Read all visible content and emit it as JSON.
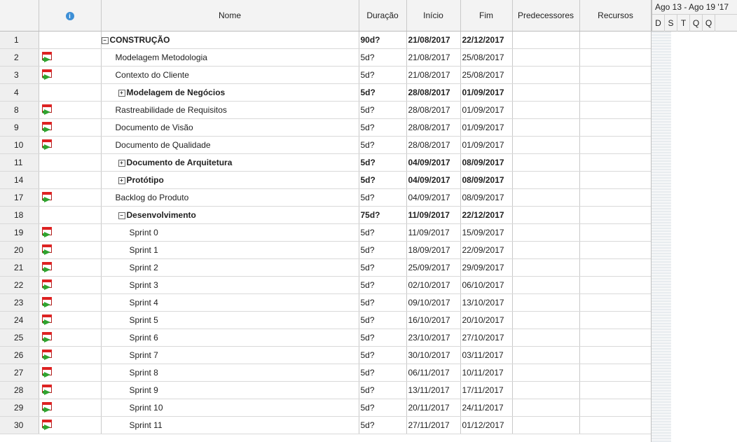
{
  "columns": {
    "name": "Nome",
    "duration": "Duração",
    "start": "Início",
    "finish": "Fim",
    "predecessors": "Predecessores",
    "resources": "Recursos"
  },
  "timeline": {
    "week_label": "Ago 13 - Ago 19 '17",
    "days": [
      "D",
      "S",
      "T",
      "Q",
      "Q"
    ]
  },
  "rows": [
    {
      "id": "1",
      "name": "CONSTRUÇÃO",
      "duration": "90d?",
      "start": "21/08/2017",
      "finish": "22/12/2017"
    },
    {
      "id": "2",
      "name": "Modelagem Metodologia",
      "duration": "5d?",
      "start": "21/08/2017",
      "finish": "25/08/2017"
    },
    {
      "id": "3",
      "name": "Contexto do Cliente",
      "duration": "5d?",
      "start": "21/08/2017",
      "finish": "25/08/2017"
    },
    {
      "id": "4",
      "name": "Modelagem de Negócios",
      "duration": "5d?",
      "start": "28/08/2017",
      "finish": "01/09/2017"
    },
    {
      "id": "8",
      "name": "Rastreabilidade de Requisitos",
      "duration": "5d?",
      "start": "28/08/2017",
      "finish": "01/09/2017"
    },
    {
      "id": "9",
      "name": "Documento de Visão",
      "duration": "5d?",
      "start": "28/08/2017",
      "finish": "01/09/2017"
    },
    {
      "id": "10",
      "name": "Documento de Qualidade",
      "duration": "5d?",
      "start": "28/08/2017",
      "finish": "01/09/2017"
    },
    {
      "id": "11",
      "name": "Documento de Arquitetura",
      "duration": "5d?",
      "start": "04/09/2017",
      "finish": "08/09/2017"
    },
    {
      "id": "14",
      "name": "Protótipo",
      "duration": "5d?",
      "start": "04/09/2017",
      "finish": "08/09/2017"
    },
    {
      "id": "17",
      "name": "Backlog do Produto",
      "duration": "5d?",
      "start": "04/09/2017",
      "finish": "08/09/2017"
    },
    {
      "id": "18",
      "name": "Desenvolvimento",
      "duration": "75d?",
      "start": "11/09/2017",
      "finish": "22/12/2017"
    },
    {
      "id": "19",
      "name": "Sprint 0",
      "duration": "5d?",
      "start": "11/09/2017",
      "finish": "15/09/2017"
    },
    {
      "id": "20",
      "name": "Sprint 1",
      "duration": "5d?",
      "start": "18/09/2017",
      "finish": "22/09/2017"
    },
    {
      "id": "21",
      "name": "Sprint 2",
      "duration": "5d?",
      "start": "25/09/2017",
      "finish": "29/09/2017"
    },
    {
      "id": "22",
      "name": "Sprint 3",
      "duration": "5d?",
      "start": "02/10/2017",
      "finish": "06/10/2017"
    },
    {
      "id": "23",
      "name": "Sprint 4",
      "duration": "5d?",
      "start": "09/10/2017",
      "finish": "13/10/2017"
    },
    {
      "id": "24",
      "name": "Sprint 5",
      "duration": "5d?",
      "start": "16/10/2017",
      "finish": "20/10/2017"
    },
    {
      "id": "25",
      "name": "Sprint 6",
      "duration": "5d?",
      "start": "23/10/2017",
      "finish": "27/10/2017"
    },
    {
      "id": "26",
      "name": "Sprint 7",
      "duration": "5d?",
      "start": "30/10/2017",
      "finish": "03/11/2017"
    },
    {
      "id": "27",
      "name": "Sprint 8",
      "duration": "5d?",
      "start": "06/11/2017",
      "finish": "10/11/2017"
    },
    {
      "id": "28",
      "name": "Sprint 9",
      "duration": "5d?",
      "start": "13/11/2017",
      "finish": "17/11/2017"
    },
    {
      "id": "29",
      "name": "Sprint 10",
      "duration": "5d?",
      "start": "20/11/2017",
      "finish": "24/11/2017"
    },
    {
      "id": "30",
      "name": "Sprint 11",
      "duration": "5d?",
      "start": "27/11/2017",
      "finish": "01/12/2017"
    }
  ]
}
